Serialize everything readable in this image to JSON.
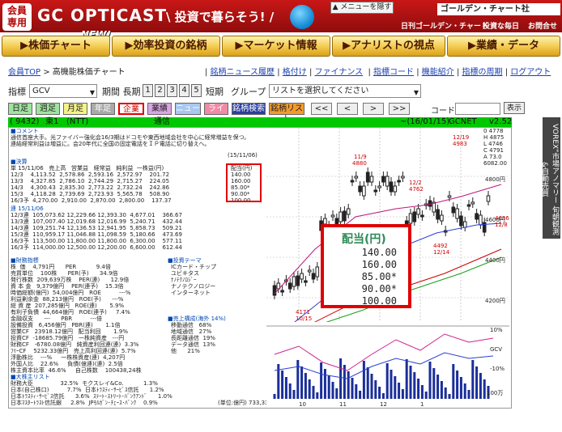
{
  "header": {
    "badge": [
      "会員",
      "専用"
    ],
    "logo": "GC OPTICAST",
    "tagline": "\\ 投資で暮らそう! /",
    "new_tag": "NEW!",
    "hide_menu": "メニューを隠す",
    "brand": "ゴールデン・チャート社",
    "links": [
      "日刊ゴールデン・チャート",
      "投資な毎日",
      "お問合せ"
    ]
  },
  "menu": [
    "株価チャート",
    "効率投資の銘柄",
    "マーケット情報",
    "アナリストの視点",
    "業績・データ"
  ],
  "breadcrumb": {
    "items": [
      "会員TOP",
      "高機能株価チャート"
    ],
    "sep": ">",
    "links": [
      "銘柄ニュース履歴",
      "格付け",
      "ファイナンス",
      "指標コード",
      "機能紹介",
      "指標の周期",
      "ログアウト"
    ]
  },
  "controls": {
    "ticker_label": "指標",
    "ticker_value": "GCV",
    "period_label": "期間 長期",
    "periods": [
      "1",
      "2",
      "3",
      "4",
      "5"
    ],
    "short_label": "短期",
    "group_label": "グループ",
    "group_value": "リストを選択してください",
    "code_label": "コード:",
    "show_button": "表示"
  },
  "tabs": [
    "日足",
    "週足",
    "月足",
    "年足",
    "企業",
    "業績",
    "ニュース",
    "ライン",
    "銘柄検索",
    "銘柄リスト"
  ],
  "nav_buttons": [
    "<<",
    "<",
    ">",
    ">>"
  ],
  "status_bar": {
    "code": "( 9432)",
    "market": "東1",
    "name": "(NTT)",
    "kind": "通信",
    "dates": "~(16/01/15)",
    "index": "GCNET",
    "version": "v2.52"
  },
  "left_panel": {
    "comment_head": "■コメント",
    "comment": "通信首座大手。光ファイバー強化会16/3期はドコモや東西地域会社を中心に経常増益を保つ。連結経常利益は増益に。会20年代に全国の固定電話をＩＰ電話に切り替えへ。",
    "settle_head": "■決算",
    "settle_cols": "単 15/11/06   売上高   営業益   経常益   純利益  一株益(円)",
    "settle_rows": [
      "12/3    4,113.52  2,578.86  2,593.16  2,572.97    201.72",
      "13/3    4,327.85  2,786.10  2,744.29  2,715.27    224.05",
      "14/3    4,300.43  2,835.30  2,773.22  2,732.24    242.86",
      "15/3    4,118.28  2,739.69  2,723.93  5,565.78    508.90",
      "16/3予  4,270.00  2,910.00  2,870.00  2,800.00    137.37"
    ],
    "consol_head": "連 15/11/06",
    "consol_rows": [
      "12/3連  105,073.62 12,229.66 12,393.30  4,677.01    366.67",
      "13/3連  107,007.40 12,019.68 12,016.99  5,240.71    432.44",
      "14/3連  109,251.74 12,136.53 12,941.95  5,858.73    509.21",
      "15/3連  110,959.17 11,046.88 11,098.59  5,180.66    473.69",
      "16/3予  113,500.00 11,800.00 11,800.00  6,300.00    577.11",
      "16/3予  114,000.00 12,500.00 12,200.00  6,600.00    612.44"
    ],
    "index_head": "■財務指標",
    "index_rows": [
      "株  価    4,791円      PER           9.4倍",
      "売買単位    100株      PER(予)      34.9倍",
      "発行株数  209,639万株    PER(連)      12.9倍",
      "資 本 金   9,379億円    PER(連予)    15.3倍",
      "時価総額(億円)  54,004億円   ROE          ---%",
      "利益剰余金  88,213億円   ROE(予)      ---%",
      "総 資 産  207,285億円   ROE(連)       5.9%",
      "有利子負債  44,664億円   ROE(連予)     7.4%",
      "金融収支      ---      PBR          ---倍",
      "設備投資   6,456億円   PBR(連)       1.1倍",
      "営業CF   23918.12億円   配当利回       1.9%",
      "投資CF  -18685.79億円   一株純資産   ---円",
      "財務CF   -6780.08億円   純資産利回連(連)  3.3%",
      "ﾌﾘｰCF    5232.33億円   売上高利回連(連)  5.7%",
      "浮動株比    ---%     一株株資産(連)  4,207円",
      "外国人比    22.6%     負債(億連)(連)  2.5倍",
      "株主資本比率  46.6%     自己株数    100438,24株"
    ],
    "holder_head": "■大株主リスト",
    "holder_rows": [
      "財務大臣               32.5%  モクスレイ&Co.           1.3%",
      "日本(自己株口)          7.7%  日本ﾄﾗｽﾃｨ･ｻｰﾋﾞｽ信託      1.2%",
      "日本ﾄﾗｽﾃｨ･ｻｰﾋﾞｽ信託      3.6%  ｽﾃｰﾄ･ｽﾄﾘｰﾄ･ﾊﾞﾝｸｱﾝﾄﾞ      1.0%",
      "日本ﾏｽﾀｰﾄﾗｽﾄ信託銀     2.8%  JPﾓﾙｶﾞﾝ･ﾁｪｰｽ･ﾊﾞﾝｸ    0.9%"
    ],
    "theme_head": "■投資テーマ",
    "themes": [
      "ICカード・チップ",
      "ユビキタス",
      "ﾅﾉﾃｸﾉﾛｼﾞｰ",
      "ナノテクノロジー",
      "インターネット"
    ],
    "segment_head": "■売上構成(海外 14%)",
    "segments": [
      "移動通信   68%",
      "地域通信   27%",
      "長距離通信  19%",
      "データ通信  13%",
      "他      21%"
    ],
    "unit_note": "(単位:億円)",
    "holders_total": "733,338",
    "divpay_head": "(15/11/06)",
    "div_col_head": "配当(円)",
    "div_small": [
      "140.00",
      "160.00",
      "85.00*",
      "90.00*",
      "100.00"
    ]
  },
  "zoom": {
    "title": "配当(円)",
    "values": [
      "140.00",
      "160.00",
      "85.00*",
      "90.00*",
      "100.00"
    ]
  },
  "chart_labels": {
    "top_peak": "12/19",
    "top_peak_val": "4983",
    "peak2": "11/9",
    "peak2_val": "4880",
    "mid_low": "12/2",
    "mid_low_val": "4762",
    "low1": "4171",
    "low1_date": "10/15",
    "low2": "4492",
    "low2_date": "12/14",
    "last": "4636",
    "last_date": "12/8",
    "right_vals": [
      "0 4778",
      "H 4875",
      "L 4746",
      "C 4791",
      "A 73.0",
      "6082.00"
    ],
    "y_axis": [
      "4800円",
      "4600円",
      "4400円",
      "4200円"
    ],
    "vol_axis": [
      "10%",
      "GCV",
      "-10%",
      "100万"
    ],
    "x_axis": [
      "10",
      "11",
      "12",
      "1"
    ]
  },
  "side_tab": "VOREX”市場アノマリー 旬朝観測 &自動売買"
}
